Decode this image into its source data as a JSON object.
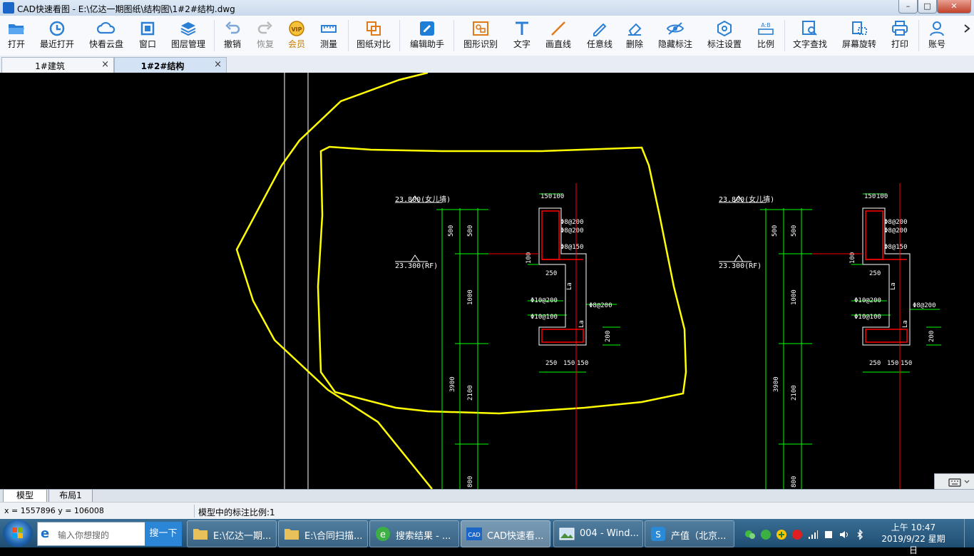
{
  "window": {
    "title": "CAD快速看图 - E:\\亿达一期图纸\\结构图\\1#2#结构.dwg",
    "minimize": "–",
    "maximize": "□",
    "close": "✕"
  },
  "toolbar": {
    "items": [
      {
        "label": "打开",
        "icon": "folder-open-icon"
      },
      {
        "label": "最近打开",
        "icon": "history-icon"
      },
      {
        "label": "快看云盘",
        "icon": "cloud-icon"
      },
      {
        "label": "窗口",
        "icon": "window-icon"
      },
      {
        "label": "图层管理",
        "icon": "layers-icon"
      },
      {
        "label": "撤销",
        "icon": "undo-icon"
      },
      {
        "label": "恢复",
        "icon": "redo-icon"
      },
      {
        "label": "会员",
        "icon": "vip-icon"
      },
      {
        "label": "测量",
        "icon": "ruler-icon"
      },
      {
        "label": "图纸对比",
        "icon": "compare-icon"
      },
      {
        "label": "编辑助手",
        "icon": "edit-helper-icon"
      },
      {
        "label": "图形识别",
        "icon": "shape-recognize-icon"
      },
      {
        "label": "文字",
        "icon": "text-icon"
      },
      {
        "label": "画直线",
        "icon": "line-icon"
      },
      {
        "label": "任意线",
        "icon": "freehand-icon"
      },
      {
        "label": "删除",
        "icon": "eraser-icon"
      },
      {
        "label": "隐藏标注",
        "icon": "hide-icon"
      },
      {
        "label": "标注设置",
        "icon": "annotation-settings-icon"
      },
      {
        "label": "比例",
        "icon": "scale-icon"
      },
      {
        "label": "文字查找",
        "icon": "text-search-icon"
      },
      {
        "label": "屏幕旋转",
        "icon": "rotate-screen-icon"
      },
      {
        "label": "打印",
        "icon": "printer-icon"
      },
      {
        "label": "账号",
        "icon": "account-icon"
      }
    ]
  },
  "tabs": [
    {
      "label": "1#建筑",
      "close": "×",
      "active": false
    },
    {
      "label": "1#2#结构",
      "close": "×",
      "active": true
    }
  ],
  "drawing": {
    "left": {
      "elev_top": "23.800(女儿墙)",
      "elev_rf": "23.300(RF)",
      "dims_vertical": [
        "500",
        "500",
        "1000",
        "3900",
        "2100",
        "800"
      ],
      "dims_top": [
        "150",
        "100"
      ],
      "rebar_labels": [
        "Φ8@200",
        "Φ8@200",
        "Φ8@150",
        "Φ10@200",
        "Φ8@200",
        "Φ10@100"
      ],
      "dim_250a": "250",
      "dim_100": "100",
      "dim_200": "200",
      "la1": "La",
      "la2": "La",
      "dims_bottom": [
        "250",
        "150",
        "150"
      ]
    },
    "right": {
      "elev_top": "23.800(女儿墙)",
      "elev_rf": "23.300(RF)",
      "dims_vertical": [
        "500",
        "500",
        "1000",
        "3900",
        "2100",
        "800"
      ],
      "dims_top": [
        "150",
        "100"
      ],
      "rebar_labels": [
        "Φ8@200",
        "Φ8@200",
        "Φ8@150",
        "Φ10@200",
        "Φ8@200",
        "Φ10@100"
      ],
      "dim_250a": "250",
      "dim_100": "100",
      "dim_200": "200",
      "la1": "La",
      "la2": "La",
      "dims_bottom": [
        "250",
        "150",
        "150"
      ]
    }
  },
  "layout_tabs": [
    {
      "label": "模型",
      "active": true
    },
    {
      "label": "布局1",
      "active": false
    }
  ],
  "status": {
    "coords": "x = 1557896  y = 106008",
    "scale": "模型中的标注比例:1"
  },
  "taskbar": {
    "search_placeholder": "输入你想搜的",
    "search_button": "搜一下",
    "tasks": [
      {
        "label": "E:\\亿达一期...",
        "icon": "folder-icon"
      },
      {
        "label": "E:\\合同扫描...",
        "icon": "folder-icon"
      },
      {
        "label": "搜索结果 - ...",
        "icon": "browser-icon"
      },
      {
        "label": "CAD快速看...",
        "icon": "cad-app-icon"
      },
      {
        "label": "004 - Wind...",
        "icon": "photo-viewer-icon"
      },
      {
        "label": "产值（北京...",
        "icon": "wps-icon"
      }
    ],
    "clock_time": "上午 10:47",
    "clock_date": "2019/9/22 星期日"
  },
  "colors": {
    "cad_bg": "#000000",
    "green": "#00ff00",
    "red": "#ff0000",
    "yellow": "#ffff00",
    "white": "#ffffff"
  }
}
